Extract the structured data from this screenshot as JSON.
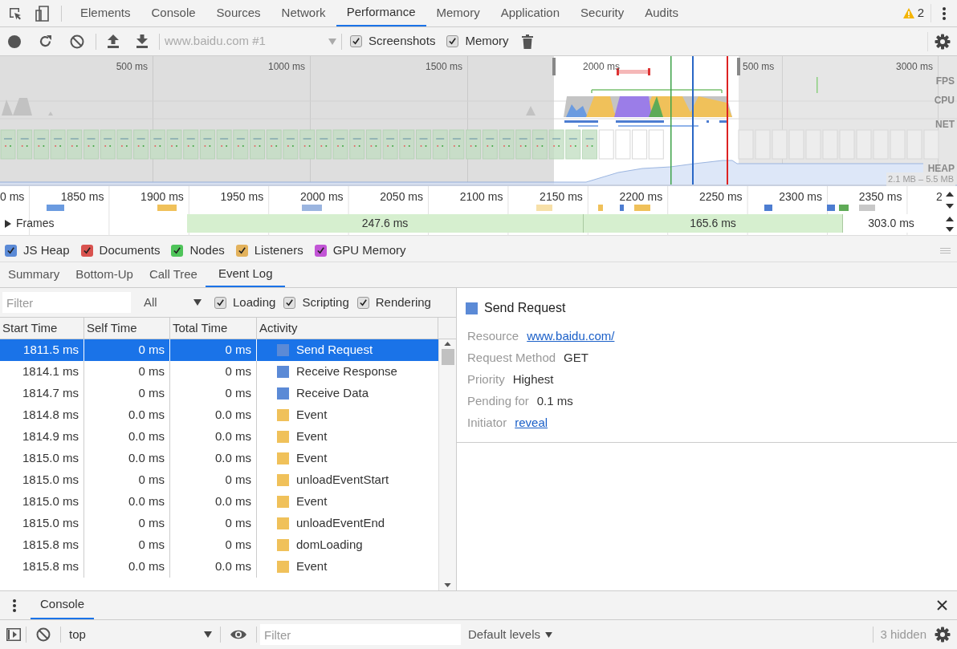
{
  "tabs": [
    {
      "label": "Elements",
      "selected": false
    },
    {
      "label": "Console",
      "selected": false
    },
    {
      "label": "Sources",
      "selected": false
    },
    {
      "label": "Network",
      "selected": false
    },
    {
      "label": "Performance",
      "selected": true
    },
    {
      "label": "Memory",
      "selected": false
    },
    {
      "label": "Application",
      "selected": false
    },
    {
      "label": "Security",
      "selected": false
    },
    {
      "label": "Audits",
      "selected": false
    }
  ],
  "warning_count": "2",
  "toolbar": {
    "profile_select": {
      "value": "www.baidu.com #1",
      "disabled": true
    },
    "checkboxes": [
      {
        "label": "Screenshots",
        "checked": true
      },
      {
        "label": "Memory",
        "checked": true
      }
    ]
  },
  "overview": {
    "ticks": [
      "500 ms",
      "1000 ms",
      "1500 ms",
      "2000 ms",
      "500 ms",
      "3000 ms"
    ],
    "tracks": [
      "FPS",
      "CPU",
      "NET",
      "HEAP"
    ],
    "heap_range": "2.1 MB – 5.5 MB"
  },
  "ruler": {
    "ticks": [
      "0 ms",
      "1850 ms",
      "1900 ms",
      "1950 ms",
      "2000 ms",
      "2050 ms",
      "2100 ms",
      "2150 ms",
      "2200 ms",
      "2250 ms",
      "2300 ms",
      "2350 ms",
      "2"
    ]
  },
  "frames": {
    "label": "Frames",
    "expanded": false,
    "bars": [
      {
        "label": "247.6 ms",
        "kind": "rendered"
      },
      {
        "label": "165.6 ms",
        "kind": "rendered"
      },
      {
        "label": "303.0 ms",
        "kind": "idle"
      }
    ]
  },
  "counters": [
    {
      "label": "JS Heap",
      "checked": true,
      "color": "#5b8ad6"
    },
    {
      "label": "Documents",
      "checked": true,
      "color": "#d9534f"
    },
    {
      "label": "Nodes",
      "checked": true,
      "color": "#4fc45a"
    },
    {
      "label": "Listeners",
      "checked": true,
      "color": "#e3b25c"
    },
    {
      "label": "GPU Memory",
      "checked": true,
      "color": "#c255d6"
    }
  ],
  "detail_tabs": [
    {
      "label": "Summary",
      "selected": false
    },
    {
      "label": "Bottom-Up",
      "selected": false
    },
    {
      "label": "Call Tree",
      "selected": false
    },
    {
      "label": "Event Log",
      "selected": true
    }
  ],
  "filter": {
    "placeholder": "Filter",
    "category": "All",
    "checkboxes": [
      {
        "label": "Loading",
        "checked": true
      },
      {
        "label": "Scripting",
        "checked": true
      },
      {
        "label": "Rendering",
        "checked": true
      }
    ]
  },
  "table": {
    "columns": [
      "Start Time",
      "Self Time",
      "Total Time",
      "Activity"
    ],
    "rows": [
      {
        "start": "1811.5 ms",
        "self": "0 ms",
        "total": "0 ms",
        "activity": "Send Request",
        "color": "#5b8ad6",
        "selected": true
      },
      {
        "start": "1814.1 ms",
        "self": "0 ms",
        "total": "0 ms",
        "activity": "Receive Response",
        "color": "#5b8ad6",
        "selected": false
      },
      {
        "start": "1814.7 ms",
        "self": "0 ms",
        "total": "0 ms",
        "activity": "Receive Data",
        "color": "#5b8ad6",
        "selected": false
      },
      {
        "start": "1814.8 ms",
        "self": "0.0 ms",
        "total": "0.0 ms",
        "activity": "Event",
        "color": "#f0c15a",
        "selected": false
      },
      {
        "start": "1814.9 ms",
        "self": "0.0 ms",
        "total": "0.0 ms",
        "activity": "Event",
        "color": "#f0c15a",
        "selected": false
      },
      {
        "start": "1815.0 ms",
        "self": "0.0 ms",
        "total": "0.0 ms",
        "activity": "Event",
        "color": "#f0c15a",
        "selected": false
      },
      {
        "start": "1815.0 ms",
        "self": "0 ms",
        "total": "0 ms",
        "activity": "unloadEventStart",
        "color": "#f0c15a",
        "selected": false
      },
      {
        "start": "1815.0 ms",
        "self": "0.0 ms",
        "total": "0.0 ms",
        "activity": "Event",
        "color": "#f0c15a",
        "selected": false
      },
      {
        "start": "1815.0 ms",
        "self": "0 ms",
        "total": "0 ms",
        "activity": "unloadEventEnd",
        "color": "#f0c15a",
        "selected": false
      },
      {
        "start": "1815.8 ms",
        "self": "0 ms",
        "total": "0 ms",
        "activity": "domLoading",
        "color": "#f0c15a",
        "selected": false
      },
      {
        "start": "1815.8 ms",
        "self": "0.0 ms",
        "total": "0.0 ms",
        "activity": "Event",
        "color": "#f0c15a",
        "selected": false
      }
    ]
  },
  "details": {
    "title": "Send Request",
    "color": "#5b8ad6",
    "fields": [
      {
        "label": "Resource",
        "value": "www.baidu.com/",
        "kind": "link"
      },
      {
        "label": "Request Method",
        "value": "GET",
        "kind": "text"
      },
      {
        "label": "Priority",
        "value": "Highest",
        "kind": "text"
      },
      {
        "label": "Pending for",
        "value": "0.1 ms",
        "kind": "text"
      },
      {
        "label": "Initiator",
        "value": "reveal",
        "kind": "link"
      }
    ]
  },
  "drawer": {
    "tab": "Console",
    "context": "top",
    "filter_placeholder": "Filter",
    "levels": "Default levels",
    "hidden": "3 hidden"
  }
}
